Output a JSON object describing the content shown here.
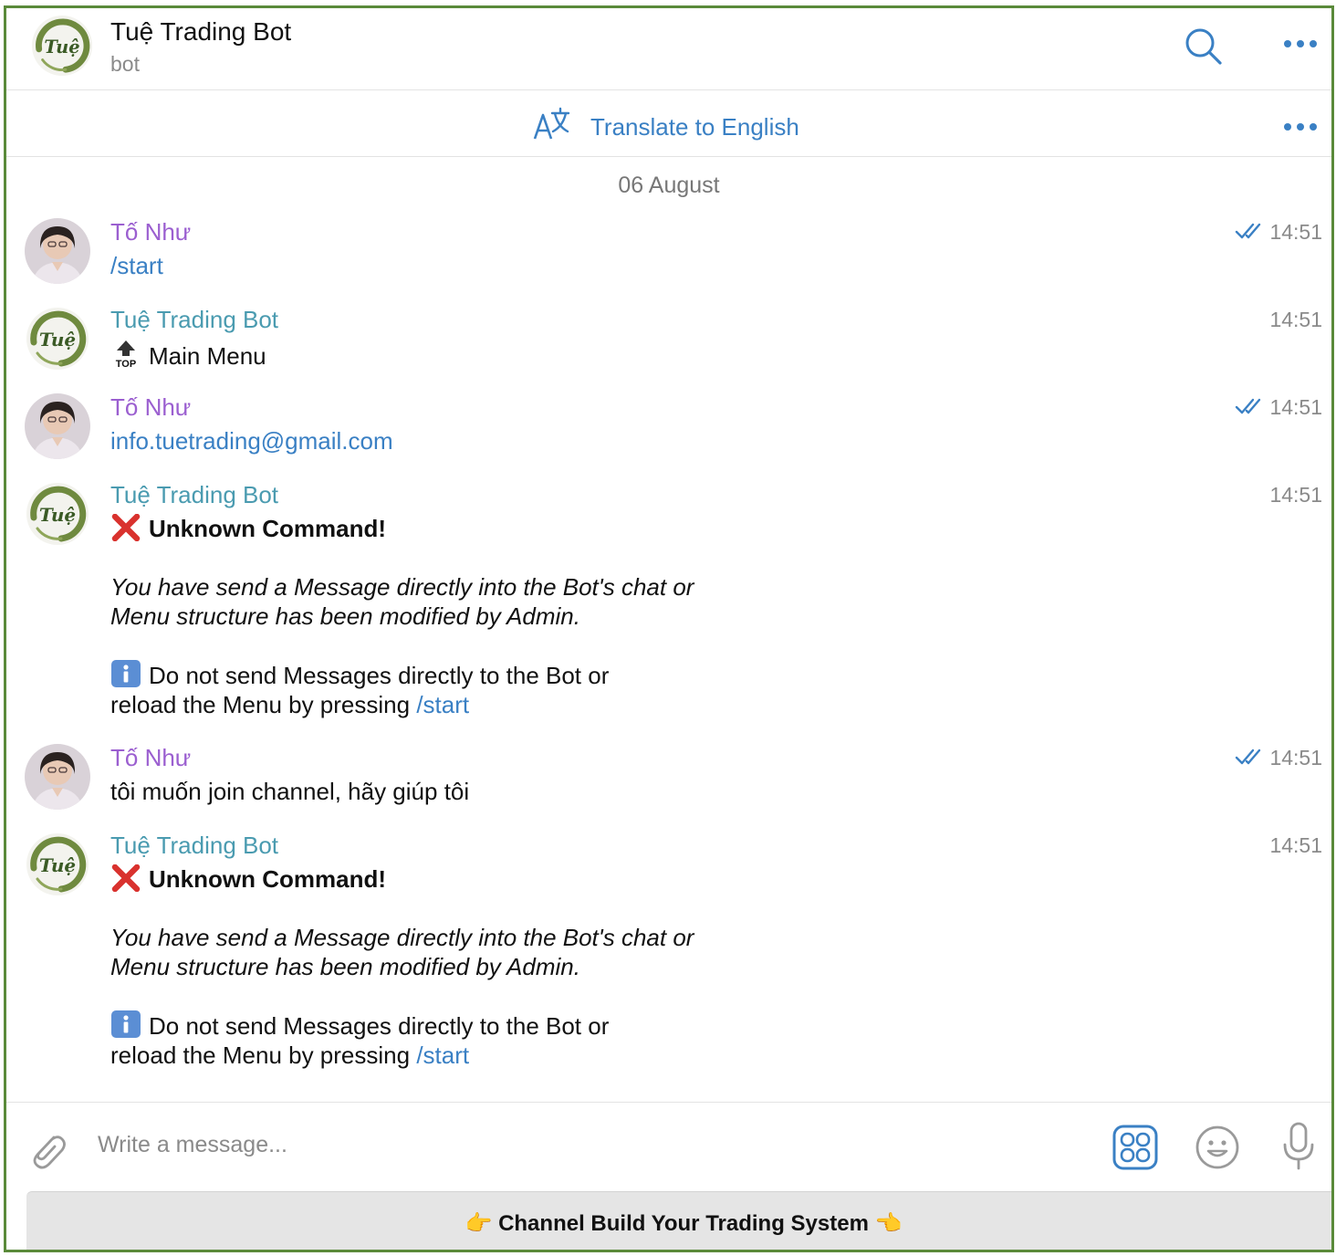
{
  "header": {
    "title": "Tuệ Trading Bot",
    "subtitle": "bot",
    "bot_logo_text": "Tuệ"
  },
  "translate": {
    "label": "Translate to English"
  },
  "date_separator": "06 August",
  "messages": [
    {
      "sender": "Tố Như",
      "time": "14:51",
      "text": "/start"
    },
    {
      "sender": "Tuệ Trading Bot",
      "time": "14:51",
      "text": "Main Menu"
    },
    {
      "sender": "Tố Như",
      "time": "14:51",
      "text": "info.tuetrading@gmail.com"
    },
    {
      "sender": "Tuệ Trading Bot",
      "time": "14:51",
      "heading": "Unknown Command!",
      "italic_1": "You have send a Message directly into the Bot's chat or",
      "italic_2": "Menu structure has been modified by Admin.",
      "info_1": "Do not send Messages directly to the Bot or",
      "info_2": "reload the Menu by pressing",
      "command": "/start"
    },
    {
      "sender": "Tố Như",
      "time": "14:51",
      "text": "tôi muốn join channel, hãy giúp tôi"
    },
    {
      "sender": "Tuệ Trading Bot",
      "time": "14:51",
      "heading": "Unknown Command!",
      "italic_1": "You have send a Message directly into the Bot's chat or",
      "italic_2": "Menu structure has been modified by Admin.",
      "info_1": "Do not send Messages directly to the Bot or",
      "info_2": "reload the Menu by pressing",
      "command": "/start"
    }
  ],
  "composer": {
    "placeholder": "Write a message..."
  },
  "keyboard": {
    "button_label": "👉 Channel Build Your Trading System 👈"
  },
  "colors": {
    "accent": "#3a80c4",
    "user_name": "#9b5fd0",
    "bot_name": "#4a9bb0",
    "frame": "#5a8a3a"
  }
}
